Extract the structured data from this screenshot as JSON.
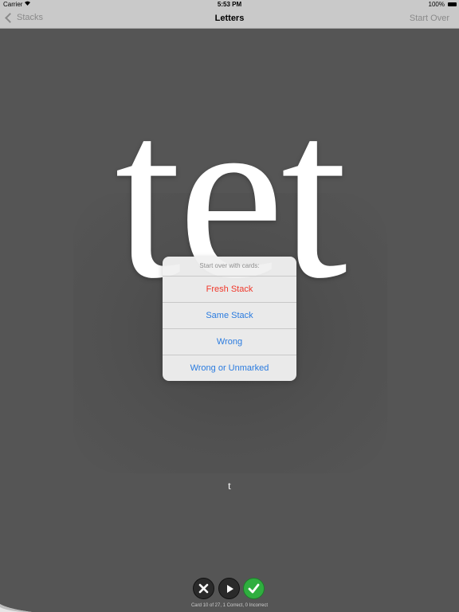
{
  "status_bar": {
    "carrier": "Carrier",
    "time": "5:53 PM",
    "battery": "100%"
  },
  "nav": {
    "back_label": "Stacks",
    "title": "Letters",
    "right_label": "Start Over"
  },
  "card": {
    "word": "tet",
    "answer": "t"
  },
  "action_sheet": {
    "header": "Start over with cards:",
    "options": [
      "Fresh Stack",
      "Same Stack",
      "Wrong",
      "Wrong or Unmarked"
    ]
  },
  "footer": {
    "progress": "Card 10 of 27, 1 Correct, 0 Incorrect"
  },
  "colors": {
    "background": "#555555",
    "accent": "#2a7bdf",
    "destructive": "#f0382b",
    "correct": "#2fae3f"
  }
}
